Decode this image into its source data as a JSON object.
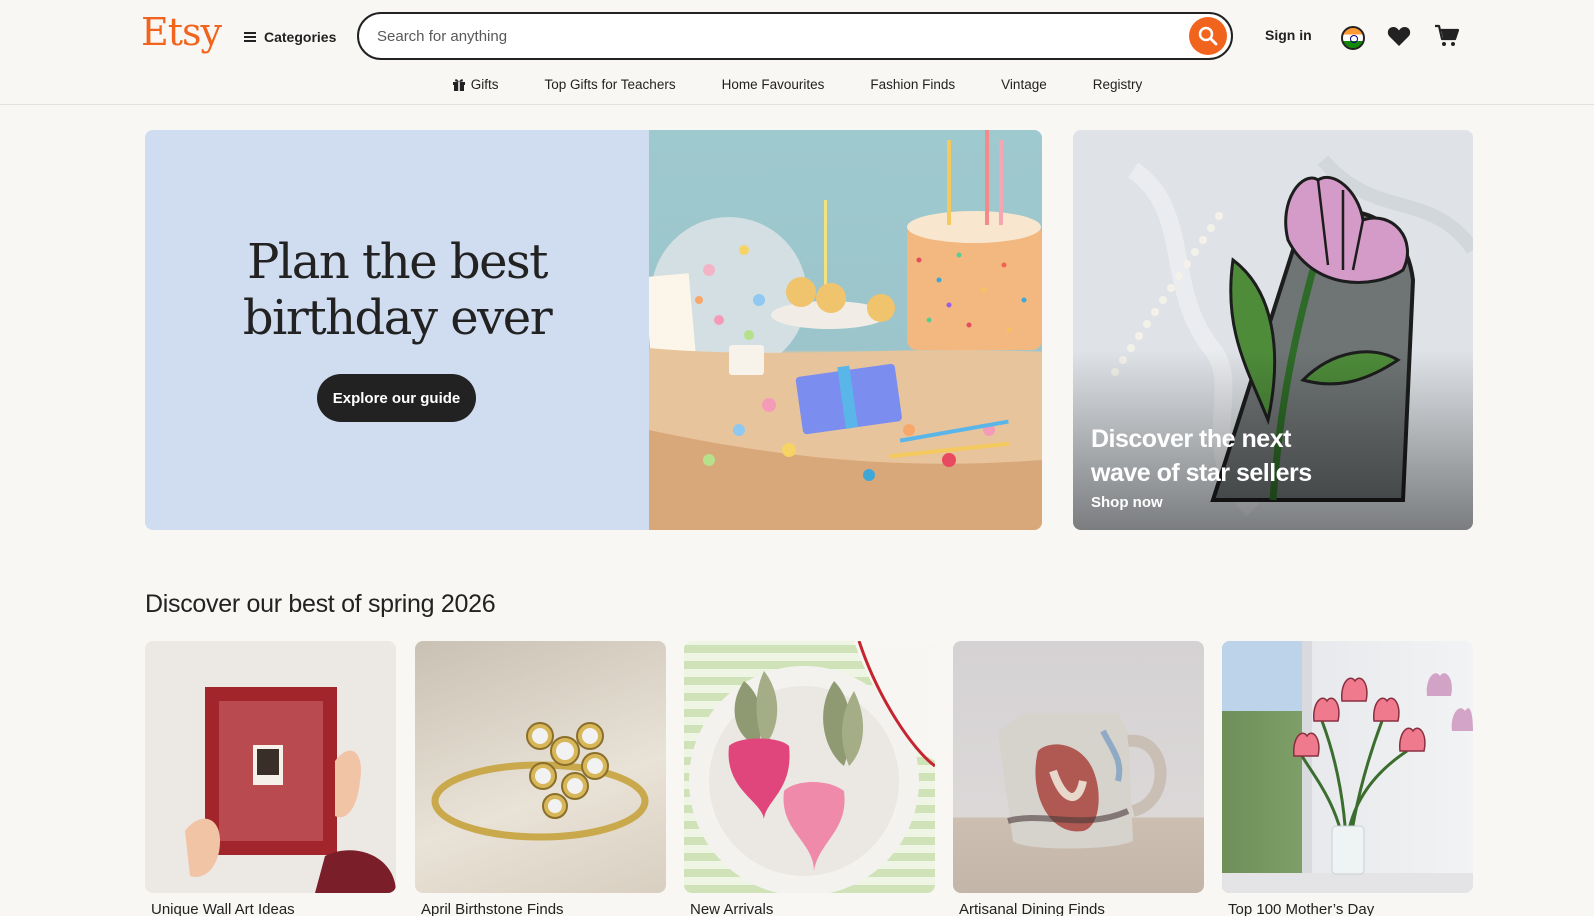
{
  "header": {
    "logo": "Etsy",
    "categories_label": "Categories",
    "search_placeholder": "Search for anything",
    "signin_label": "Sign in"
  },
  "subnav": {
    "items": [
      {
        "label": "Gifts",
        "icon": "gift-icon"
      },
      {
        "label": "Top Gifts for Teachers"
      },
      {
        "label": "Home Favourites"
      },
      {
        "label": "Fashion Finds"
      },
      {
        "label": "Vintage"
      },
      {
        "label": "Registry"
      }
    ]
  },
  "hero": {
    "title_line1": "Plan the best",
    "title_line2": "birthday ever",
    "button_label": "Explore our guide",
    "side_title_line1": "Discover the next",
    "side_title_line2": "wave of star sellers",
    "side_link": "Shop now"
  },
  "section": {
    "title": "Discover our best of spring 2026",
    "cards": [
      {
        "label": "Unique Wall Art Ideas"
      },
      {
        "label": "April Birthstone Finds"
      },
      {
        "label": "New Arrivals"
      },
      {
        "label": "Artisanal Dining Finds"
      },
      {
        "label": "Top 100 Mother’s Day"
      }
    ]
  },
  "colors": {
    "brand": "#f1641e",
    "hero_bg": "#d0dcf0",
    "dark": "#222222"
  }
}
